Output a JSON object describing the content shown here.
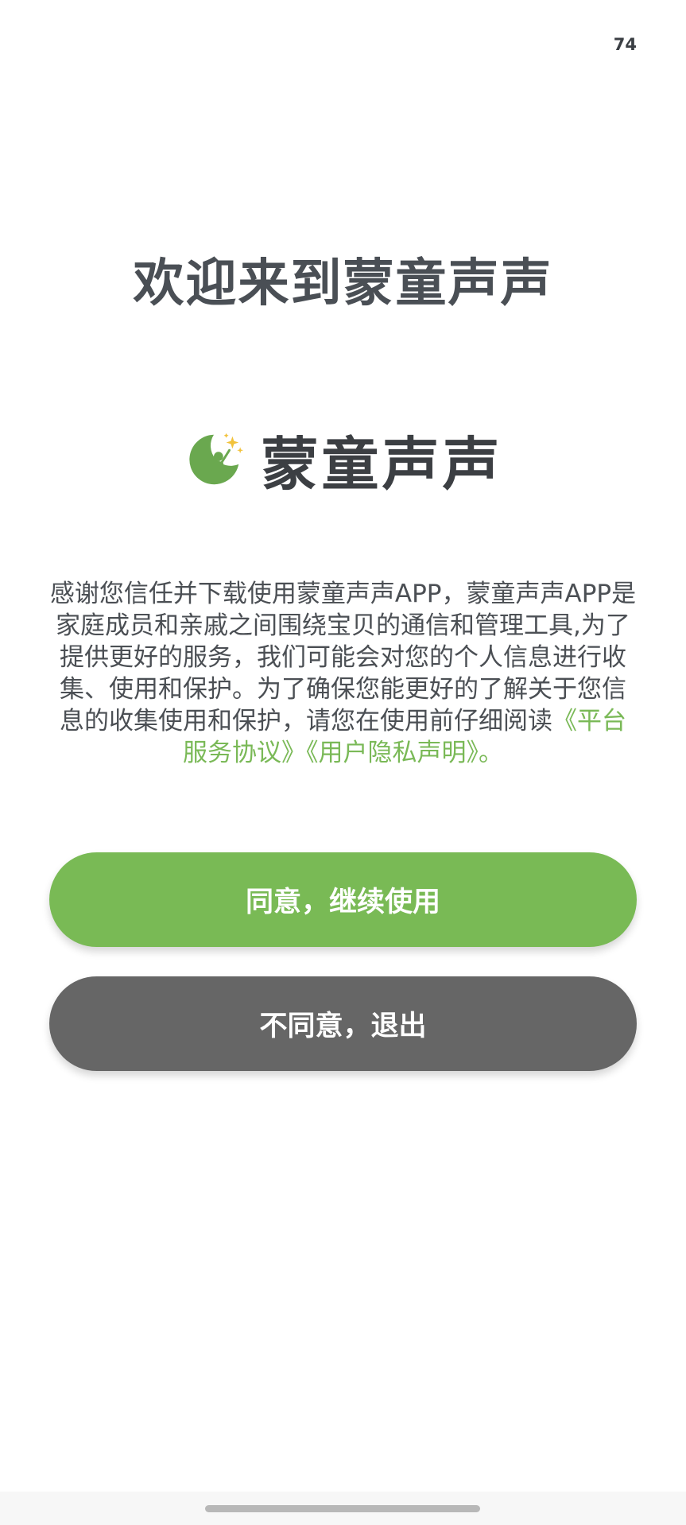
{
  "status_bar": {
    "number": "74"
  },
  "welcome": {
    "title": "欢迎来到蒙童声声"
  },
  "logo": {
    "icon": "moon-child-stars-icon",
    "text": "蒙童声声",
    "colors": {
      "moon": "#6aa84f",
      "stars": "#f2c23b"
    }
  },
  "intro": {
    "body": "感谢您信任并下载使用蒙童声声APP，蒙童声声APP是家庭成员和亲戚之间围绕宝贝的通信和管理工具,为了提供更好的服务，我们可能会对您的个人信息进行收集、使用和保护。为了确保您能更好的了解关于您信息的收集使用和保护，请您在使用前仔细阅读",
    "link_platform": "《平台服务协议》",
    "link_privacy": "《用户隐私声明》",
    "suffix": "。"
  },
  "buttons": {
    "agree_label": "同意，继续使用",
    "disagree_label": "不同意，退出"
  },
  "colors": {
    "accent_green": "#79ba55",
    "disagree_gray": "#666666"
  }
}
